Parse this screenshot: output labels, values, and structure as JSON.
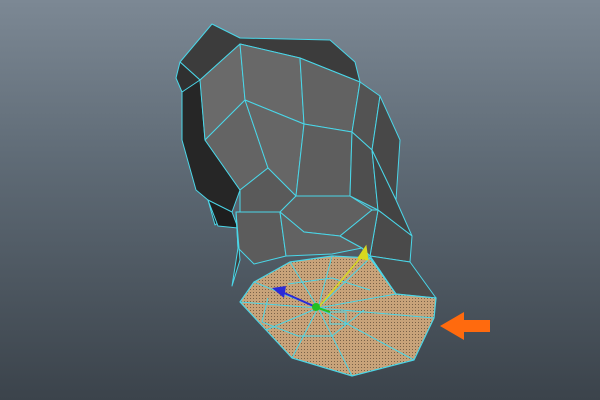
{
  "viewport": {
    "background_top": "#7c8894",
    "background_bottom": "#3b434b"
  },
  "mesh": {
    "wire_color": "#4ad6e8",
    "shade_light": "#6a6a6a",
    "shade_mid": "#555555",
    "shade_dark": "#262626",
    "selection_color": "#c8a37a"
  },
  "manipulator": {
    "x_axis_color": "#2a2ad8",
    "y_axis_color": "#d8d820",
    "z_axis_color": "#22c022",
    "icon": "move-manipulator-icon"
  },
  "annotation": {
    "arrow_color": "#ff6a0e",
    "icon": "arrow-left-icon"
  }
}
